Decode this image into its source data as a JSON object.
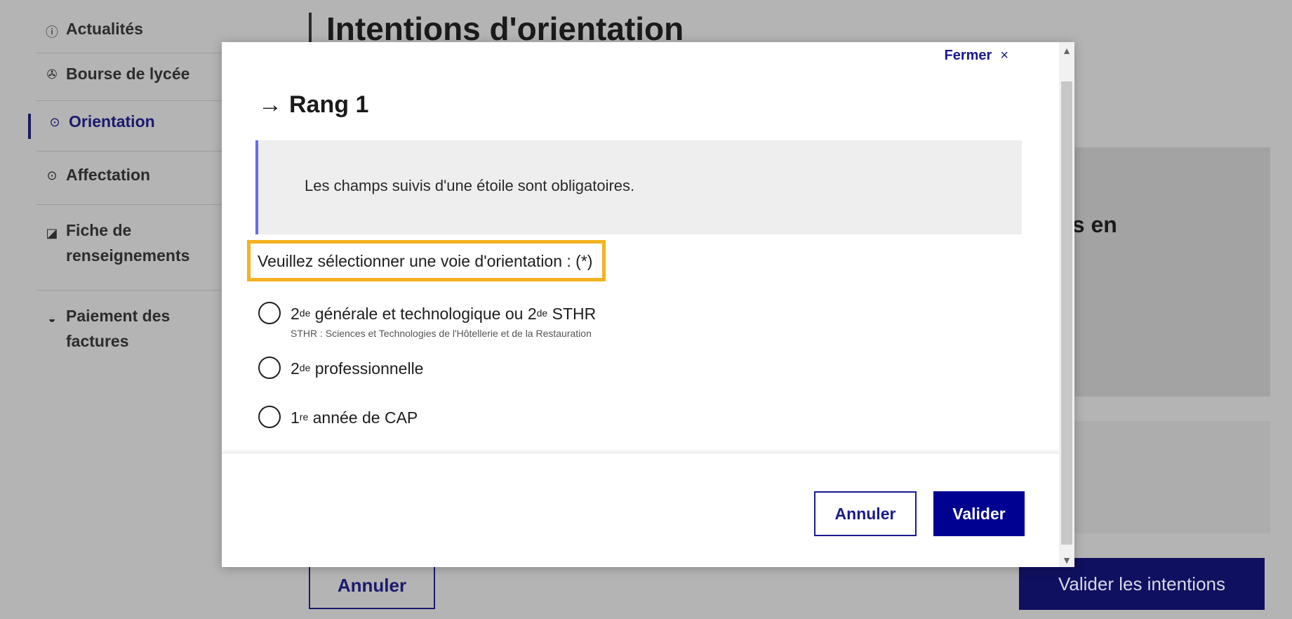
{
  "sidebar": {
    "items": [
      {
        "icon": "ⓘ",
        "label": "Actualités",
        "icon_name": "info-icon"
      },
      {
        "icon": "✇",
        "label": "Bourse de lycée",
        "icon_name": "handshake-icon"
      },
      {
        "icon": "⊙",
        "label": "Orientation",
        "icon_name": "compass-icon"
      },
      {
        "icon": "⊙",
        "label": "Affectation",
        "icon_name": "compass-icon"
      },
      {
        "icon": "◪",
        "label": "Fiche de renseignements",
        "icon_name": "edit-icon"
      },
      {
        "icon": "◒",
        "label": "Paiement des factures",
        "icon_name": "payment-icon"
      }
    ]
  },
  "page": {
    "title": "Intentions d'orientation",
    "card_text_fragment": "es en",
    "annuler_label": "Annuler",
    "valider_label": "Valider les intentions"
  },
  "modal": {
    "close_label": "Fermer",
    "close_icon": "×",
    "title_arrow": "→",
    "title": "Rang 1",
    "notice": "Les champs suivis d'une étoile sont obligatoires.",
    "legend": "Veuillez sélectionner une voie d'orientation : (*)",
    "options": [
      {
        "sup": "de",
        "prefix": "2",
        "label": " générale et technologique ou 2",
        "sup2": "de",
        "label2": " STHR",
        "hint": "STHR : Sciences et Technologies de l'Hôtellerie et de la Restauration"
      },
      {
        "prefix": "2",
        "sup": "de",
        "label": " professionnelle"
      },
      {
        "prefix": "1",
        "sup": "re",
        "label": " année de CAP"
      }
    ],
    "cancel_label": "Annuler",
    "submit_label": "Valider"
  },
  "colors": {
    "accent": "#000091",
    "highlight": "#f3b320",
    "notice_border": "#6a6af4"
  }
}
